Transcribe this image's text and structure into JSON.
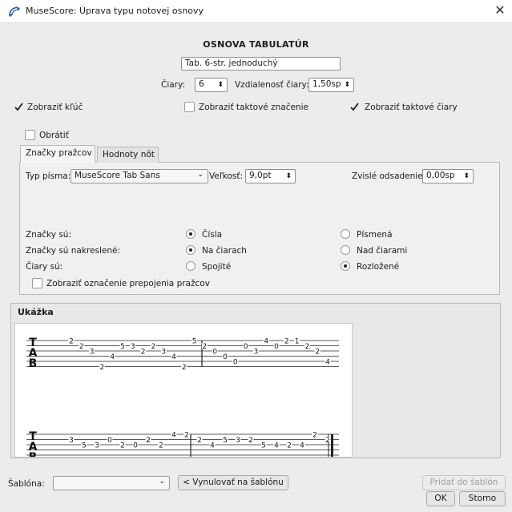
{
  "window": {
    "title": "MuseScore: Úprava typu notovej osnovy",
    "app_icon": "musescore-app-icon",
    "close_glyph": "✕"
  },
  "header": {
    "section_title": "OSNOVA TABULATÚR",
    "name_value": "Tab. 6-str. jednoduchý"
  },
  "lines": {
    "lines_label": "Čiary:",
    "lines_value": "6",
    "spacing_label": "Vzdialenosť čiary:",
    "spacing_value": "1,50sp"
  },
  "options": {
    "show_clef": {
      "label": "Zobraziť kľúč",
      "checked": true
    },
    "show_time_sig": {
      "label": "Zobraziť taktové značenie",
      "checked": false
    },
    "show_barlines": {
      "label": "Zobraziť taktové čiary",
      "checked": true
    },
    "upside_down": {
      "label": "Obrátiť",
      "checked": false
    }
  },
  "tabs": [
    {
      "label": "Značky pražcov",
      "active": true
    },
    {
      "label": "Hodnoty nôt",
      "active": false
    }
  ],
  "fret_marks": {
    "font_label": "Typ písma:",
    "font_value": "MuseScore Tab Sans",
    "size_label": "Veľkosť:",
    "size_value": "9,0pt",
    "offset_label": "Zvislé odsadenie:",
    "offset_value": "0,00sp",
    "marks_are": {
      "label": "Značky sú:",
      "options": [
        {
          "label": "Čísla",
          "selected": true
        },
        {
          "label": "Písmená",
          "selected": false
        }
      ]
    },
    "marks_drawn": {
      "label": "Značky sú nakreslené:",
      "options": [
        {
          "label": "Na čiarach",
          "selected": true
        },
        {
          "label": "Nad čiarami",
          "selected": false
        }
      ]
    },
    "lines_are": {
      "label": "Čiary sú:",
      "options": [
        {
          "label": "Spojité",
          "selected": false
        },
        {
          "label": "Rozložené",
          "selected": true
        }
      ]
    },
    "show_backtrack": {
      "label": "Zobraziť označenie prepojenia pražcov",
      "checked": false
    }
  },
  "preview": {
    "label": "Ukážka",
    "clef_letters": [
      "T",
      "A",
      "B"
    ],
    "system1_numbers": [
      {
        "t": "2",
        "s": 0
      },
      {
        "t": "2",
        "s": 1
      },
      {
        "t": "3",
        "s": 2
      },
      {
        "t": "2",
        "s": 5
      },
      {
        "t": "4",
        "s": 3
      },
      {
        "t": "5",
        "s": 1
      },
      {
        "t": "3",
        "s": 1
      },
      {
        "t": "2",
        "s": 2
      },
      {
        "t": "2",
        "s": 1
      },
      {
        "t": "3",
        "s": 2
      },
      {
        "t": "4",
        "s": 3
      },
      {
        "t": "2",
        "s": 5
      },
      {
        "t": "5",
        "s": 0
      },
      {
        "t": "2",
        "s": 1
      },
      {
        "t": "0",
        "s": 2
      },
      {
        "t": "0",
        "s": 3
      },
      {
        "t": "0",
        "s": 4
      },
      {
        "t": "0",
        "s": 1
      },
      {
        "t": "3",
        "s": 2
      },
      {
        "t": "4",
        "s": 0
      },
      {
        "t": "0",
        "s": 1
      },
      {
        "t": "2",
        "s": 0
      },
      {
        "t": "1",
        "s": 0
      },
      {
        "t": "2",
        "s": 1
      },
      {
        "t": "2",
        "s": 2
      },
      {
        "t": "4",
        "s": 4
      }
    ],
    "system2_numbers": [
      {
        "t": "3",
        "s": 1
      },
      {
        "t": "5",
        "s": 2
      },
      {
        "t": "3",
        "s": 2
      },
      {
        "t": "0",
        "s": 1
      },
      {
        "t": "2",
        "s": 2
      },
      {
        "t": "0",
        "s": 2
      },
      {
        "t": "2",
        "s": 1
      },
      {
        "t": "2",
        "s": 2
      },
      {
        "t": "4",
        "s": 0
      },
      {
        "t": "2",
        "s": 0
      },
      {
        "t": "2",
        "s": 1
      },
      {
        "t": "4",
        "s": 2
      },
      {
        "t": "5",
        "s": 1
      },
      {
        "t": "3",
        "s": 1
      },
      {
        "t": "2",
        "s": 1
      },
      {
        "t": "5",
        "s": 2
      },
      {
        "t": "4",
        "s": 2
      },
      {
        "t": "2",
        "s": 2
      },
      {
        "t": "4",
        "s": 2
      },
      {
        "t": "2",
        "s": 0
      },
      {
        "t": "2",
        "s": 1
      }
    ]
  },
  "footer": {
    "template_label": "Šablóna:",
    "template_value": "",
    "reset_label": "< Vynulovať na šablónu",
    "add_template_label": "Pridať do šablón",
    "ok_label": "OK",
    "cancel_label": "Storno"
  },
  "colors": {
    "window_bg": "#ececec",
    "check_accent": "#1f1f1f"
  }
}
